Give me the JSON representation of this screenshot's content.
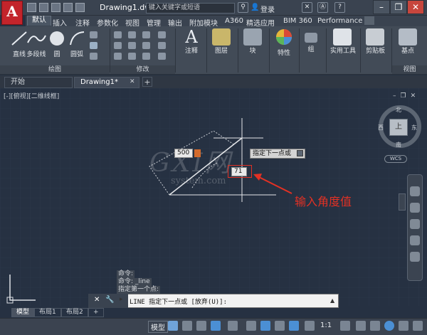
{
  "app": {
    "logo": "A",
    "title": "Drawing1.dwg",
    "search_placeholder": "键入关键字或短语",
    "login": "登录"
  },
  "ribbon_tabs": [
    "默认",
    "插入",
    "注释",
    "参数化",
    "视图",
    "管理",
    "输出",
    "附加模块",
    "A360",
    "精选应用",
    "BIM 360",
    "Performance"
  ],
  "tools": {
    "line": "直线",
    "polyline": "多段线",
    "circle": "圆",
    "arc": "圆弧",
    "annotate": "注释",
    "layers": "图层",
    "block": "块",
    "properties": "特性",
    "groups": "组",
    "utilities": "实用工具",
    "clipboard": "剪贴板",
    "base": "基点"
  },
  "panels": {
    "draw": "绘图",
    "modify": "修改",
    "view": "视图"
  },
  "doc_tabs": [
    "开始",
    "Drawing1*"
  ],
  "viewport_label": "[-][俯视][二维线框]",
  "dynamic_input": {
    "length": "500",
    "angle": "71",
    "prompt": "指定下一点或"
  },
  "viewcube": {
    "north": "北",
    "south": "南",
    "east": "东",
    "west": "西",
    "face": "上",
    "wcs": "WCS"
  },
  "annotation": "输入角度值",
  "watermark": {
    "main": "GXI网",
    "sub": "system.com"
  },
  "command_history": [
    "命令:",
    "命令: _line",
    "指定第一个点:"
  ],
  "command_line": "LINE 指定下一点或 [放弃(U)]:",
  "layout_tabs": [
    "模型",
    "布局1",
    "布局2"
  ],
  "status": {
    "model": "模型",
    "scale": "1:1"
  },
  "colors": {
    "accent_red": "#e23124",
    "app_red": "#c3242b",
    "canvas": "#263142"
  }
}
